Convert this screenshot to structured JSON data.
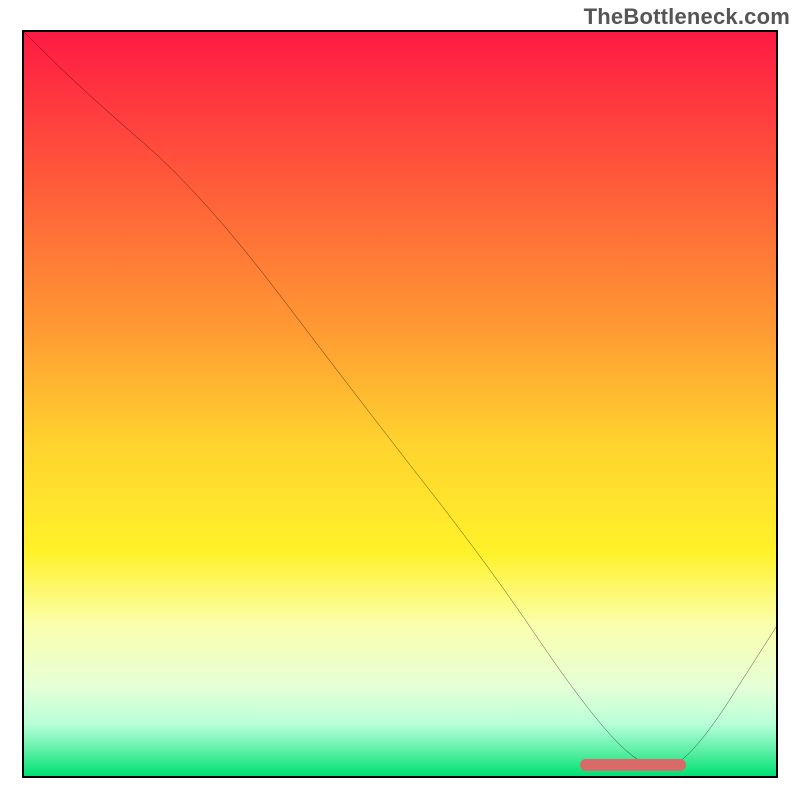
{
  "watermark": "TheBottleneck.com",
  "chart_data": {
    "type": "line",
    "title": "",
    "xlabel": "",
    "ylabel": "",
    "xlim": [
      0,
      100
    ],
    "ylim": [
      0,
      100
    ],
    "grid": false,
    "legend": false,
    "background": {
      "type": "vertical-gradient",
      "stops": [
        {
          "pos": 0.0,
          "color": "#ff1a44"
        },
        {
          "pos": 0.2,
          "color": "#ff5a3a"
        },
        {
          "pos": 0.4,
          "color": "#ff9a33"
        },
        {
          "pos": 0.55,
          "color": "#ffd22e"
        },
        {
          "pos": 0.7,
          "color": "#fff22a"
        },
        {
          "pos": 0.8,
          "color": "#faffb0"
        },
        {
          "pos": 0.88,
          "color": "#e6ffd6"
        },
        {
          "pos": 0.93,
          "color": "#b8ffd8"
        },
        {
          "pos": 0.965,
          "color": "#60f0a8"
        },
        {
          "pos": 1.0,
          "color": "#00e070"
        }
      ]
    },
    "series": [
      {
        "name": "bottleneck-curve",
        "x": [
          0,
          8,
          24,
          45,
          62,
          74,
          82,
          88,
          100
        ],
        "y": [
          100,
          92,
          78,
          50,
          28,
          10,
          1,
          1,
          20
        ]
      }
    ],
    "annotations": [
      {
        "name": "optimal-range-bar",
        "type": "hbar",
        "x_start": 74,
        "x_end": 88,
        "y": 1.5,
        "color": "#d86a6a"
      }
    ]
  }
}
